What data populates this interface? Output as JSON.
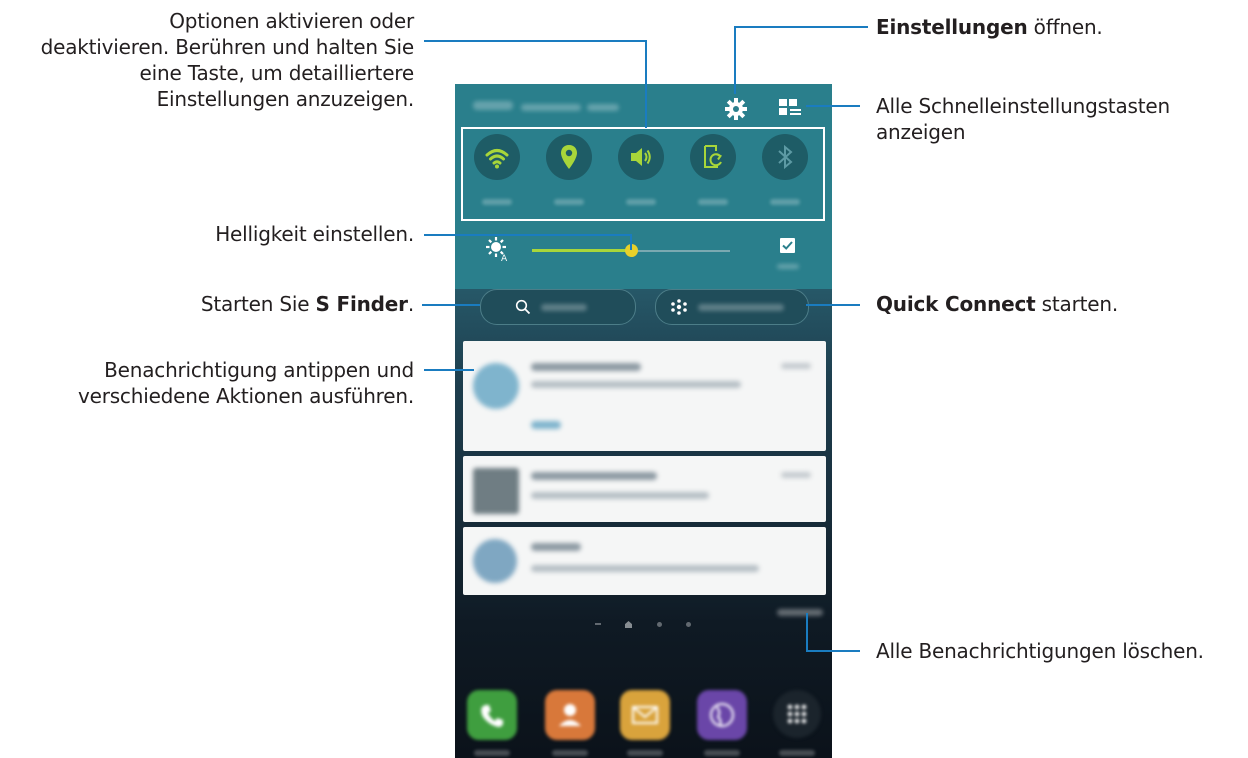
{
  "annotations": {
    "toggles": {
      "lines": [
        "Optionen aktivieren oder",
        "deaktivieren. Berühren und halten Sie",
        "eine Taste, um detailliertere",
        "Einstellungen anzuzeigen."
      ]
    },
    "brightness": {
      "text": "Helligkeit einstellen."
    },
    "sfinder": {
      "prefix": "Starten Sie ",
      "bold": "S Finder",
      "suffix": "."
    },
    "notification": {
      "lines": [
        "Benachrichtigung antippen und",
        "verschiedene Aktionen ausführen."
      ]
    },
    "settings": {
      "bold": "Einstellungen",
      "suffix": " öffnen."
    },
    "all_quick_settings": {
      "lines": [
        "Alle Schnelleinstellungstasten",
        "anzeigen"
      ]
    },
    "quick_connect": {
      "bold": "Quick Connect",
      "suffix": " starten."
    },
    "clear_all": {
      "text": "Alle Benachrichtigungen löschen."
    }
  },
  "colors": {
    "callout_line": "#1a7cc0",
    "panel": "#2a7f8c",
    "toggle_active": "#a8d63a",
    "toggle_inactive": "#5d9aa4",
    "toggle_bg": "#1e5c66",
    "brightness_track": "#a8d63a"
  },
  "phone": {
    "toggles": [
      {
        "name": "wifi-icon",
        "active": true
      },
      {
        "name": "location-icon",
        "active": true
      },
      {
        "name": "sound-icon",
        "active": true
      },
      {
        "name": "screen-rotation-icon",
        "active": true
      },
      {
        "name": "bluetooth-icon",
        "active": false
      }
    ],
    "brightness_level": 0.5,
    "auto_brightness_checked": true
  }
}
